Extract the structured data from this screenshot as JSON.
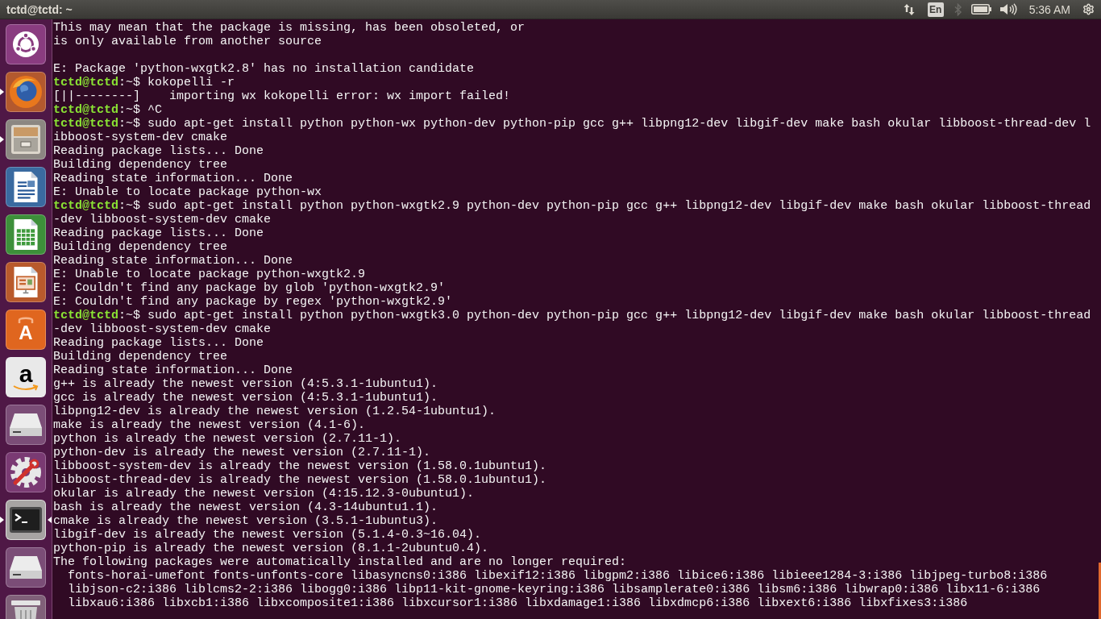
{
  "top_bar": {
    "title": "tctd@tctd: ~",
    "keyboard_layout": "En",
    "clock": "5:36 AM"
  },
  "launcher": {
    "items": [
      {
        "kind": "dash",
        "running": false,
        "selected": false
      },
      {
        "kind": "browser",
        "running": true,
        "selected": false
      },
      {
        "kind": "files",
        "running": true,
        "selected": false
      },
      {
        "kind": "writer",
        "running": false,
        "selected": false
      },
      {
        "kind": "calc",
        "running": false,
        "selected": false
      },
      {
        "kind": "impress",
        "running": false,
        "selected": false
      },
      {
        "kind": "store",
        "glyph": "A",
        "running": false,
        "selected": false
      },
      {
        "kind": "amazon",
        "glyph": "a",
        "running": false,
        "selected": false
      },
      {
        "kind": "drive",
        "running": false,
        "selected": false
      },
      {
        "kind": "settings",
        "running": false,
        "selected": false
      },
      {
        "kind": "terminal",
        "running": true,
        "selected": true
      },
      {
        "kind": "drive",
        "running": false,
        "selected": false
      },
      {
        "kind": "trash",
        "running": false,
        "selected": false
      }
    ]
  },
  "terminal": {
    "lines": [
      {
        "kind": "output",
        "text": "This may mean that the package is missing, has been obsoleted, or"
      },
      {
        "kind": "output",
        "text": "is only available from another source"
      },
      {
        "kind": "blank"
      },
      {
        "kind": "output",
        "text": "E: Package 'python-wxgtk2.8' has no installation candidate"
      },
      {
        "kind": "prompt",
        "user": "tctd@tctd",
        "text": ":~$ kokopelli -r"
      },
      {
        "kind": "output",
        "text": "[||--------]    importing wx kokopelli error: wx import failed!"
      },
      {
        "kind": "prompt",
        "user": "tctd@tctd",
        "text": ":~$ ^C"
      },
      {
        "kind": "prompt",
        "user": "tctd@tctd",
        "text": ":~$ sudo apt-get install python python-wx python-dev python-pip gcc g++ libpng12-dev libgif-dev make bash okular libboost-thread-dev l"
      },
      {
        "kind": "output",
        "text": "ibboost-system-dev cmake"
      },
      {
        "kind": "output",
        "text": "Reading package lists... Done"
      },
      {
        "kind": "output",
        "text": "Building dependency tree"
      },
      {
        "kind": "output",
        "text": "Reading state information... Done"
      },
      {
        "kind": "output",
        "text": "E: Unable to locate package python-wx"
      },
      {
        "kind": "prompt",
        "user": "tctd@tctd",
        "text": ":~$ sudo apt-get install python python-wxgtk2.9 python-dev python-pip gcc g++ libpng12-dev libgif-dev make bash okular libboost-thread"
      },
      {
        "kind": "output",
        "text": "-dev libboost-system-dev cmake"
      },
      {
        "kind": "output",
        "text": "Reading package lists... Done"
      },
      {
        "kind": "output",
        "text": "Building dependency tree"
      },
      {
        "kind": "output",
        "text": "Reading state information... Done"
      },
      {
        "kind": "output",
        "text": "E: Unable to locate package python-wxgtk2.9"
      },
      {
        "kind": "output",
        "text": "E: Couldn't find any package by glob 'python-wxgtk2.9'"
      },
      {
        "kind": "output",
        "text": "E: Couldn't find any package by regex 'python-wxgtk2.9'"
      },
      {
        "kind": "prompt",
        "user": "tctd@tctd",
        "text": ":~$ sudo apt-get install python python-wxgtk3.0 python-dev python-pip gcc g++ libpng12-dev libgif-dev make bash okular libboost-thread"
      },
      {
        "kind": "output",
        "text": "-dev libboost-system-dev cmake"
      },
      {
        "kind": "output",
        "text": "Reading package lists... Done"
      },
      {
        "kind": "output",
        "text": "Building dependency tree"
      },
      {
        "kind": "output",
        "text": "Reading state information... Done"
      },
      {
        "kind": "output",
        "text": "g++ is already the newest version (4:5.3.1-1ubuntu1)."
      },
      {
        "kind": "output",
        "text": "gcc is already the newest version (4:5.3.1-1ubuntu1)."
      },
      {
        "kind": "output",
        "text": "libpng12-dev is already the newest version (1.2.54-1ubuntu1)."
      },
      {
        "kind": "output",
        "text": "make is already the newest version (4.1-6)."
      },
      {
        "kind": "output",
        "text": "python is already the newest version (2.7.11-1)."
      },
      {
        "kind": "output",
        "text": "python-dev is already the newest version (2.7.11-1)."
      },
      {
        "kind": "output",
        "text": "libboost-system-dev is already the newest version (1.58.0.1ubuntu1)."
      },
      {
        "kind": "output",
        "text": "libboost-thread-dev is already the newest version (1.58.0.1ubuntu1)."
      },
      {
        "kind": "output",
        "text": "okular is already the newest version (4:15.12.3-0ubuntu1)."
      },
      {
        "kind": "output",
        "text": "bash is already the newest version (4.3-14ubuntu1.1)."
      },
      {
        "kind": "output",
        "text": "cmake is already the newest version (3.5.1-1ubuntu3)."
      },
      {
        "kind": "output",
        "text": "libgif-dev is already the newest version (5.1.4-0.3~16.04)."
      },
      {
        "kind": "output",
        "text": "python-pip is already the newest version (8.1.1-2ubuntu0.4)."
      },
      {
        "kind": "output",
        "text": "The following packages were automatically installed and are no longer required:"
      },
      {
        "kind": "list",
        "text": "fonts-horai-umefont fonts-unfonts-core libasyncns0:i386 libexif12:i386 libgpm2:i386 libice6:i386 libieee1284-3:i386 libjpeg-turbo8:i386"
      },
      {
        "kind": "list",
        "text": "libjson-c2:i386 liblcms2-2:i386 libogg0:i386 libp11-kit-gnome-keyring:i386 libsamplerate0:i386 libsm6:i386 libwrap0:i386 libx11-6:i386"
      },
      {
        "kind": "list",
        "text": "libxau6:i386 libxcb1:i386 libxcomposite1:i386 libxcursor1:i386 libxdamage1:i386 libxdmcp6:i386 libxext6:i386 libxfixes3:i386"
      }
    ]
  }
}
